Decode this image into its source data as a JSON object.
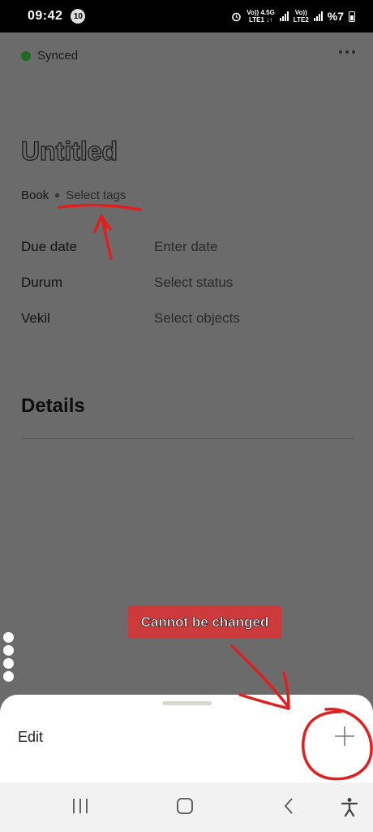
{
  "status_bar": {
    "time": "09:42",
    "notification_count": "10",
    "net1_top": "Vo)) 4.5G",
    "net1_bottom": "LTE1 ↓↑",
    "net2_top": "Vo))",
    "net2_bottom": "LTE2",
    "battery": "%7"
  },
  "header": {
    "sync_status": "Synced",
    "more_icon": "more-horizontal-icon"
  },
  "page": {
    "title": "Untitled",
    "type_label": "Book",
    "tags_placeholder": "Select tags"
  },
  "properties": [
    {
      "name": "Due date",
      "value": "Enter date"
    },
    {
      "name": "Durum",
      "value": "Select status"
    },
    {
      "name": "Vekil",
      "value": "Select objects"
    }
  ],
  "section": {
    "details_heading": "Details"
  },
  "annotation": {
    "callout_text": "Cannot be changed"
  },
  "bottom_sheet": {
    "edit_label": "Edit",
    "add_icon": "plus-icon"
  },
  "nav_bar": {
    "recents_icon": "recents-icon",
    "home_icon": "home-icon",
    "back_icon": "back-icon",
    "accessibility_icon": "accessibility-icon"
  },
  "colors": {
    "dim_overlay": "#6b6b6b",
    "sync_green": "#1f6b1f",
    "annotation_red": "#cc3a3c",
    "ink_red": "#e02020"
  }
}
